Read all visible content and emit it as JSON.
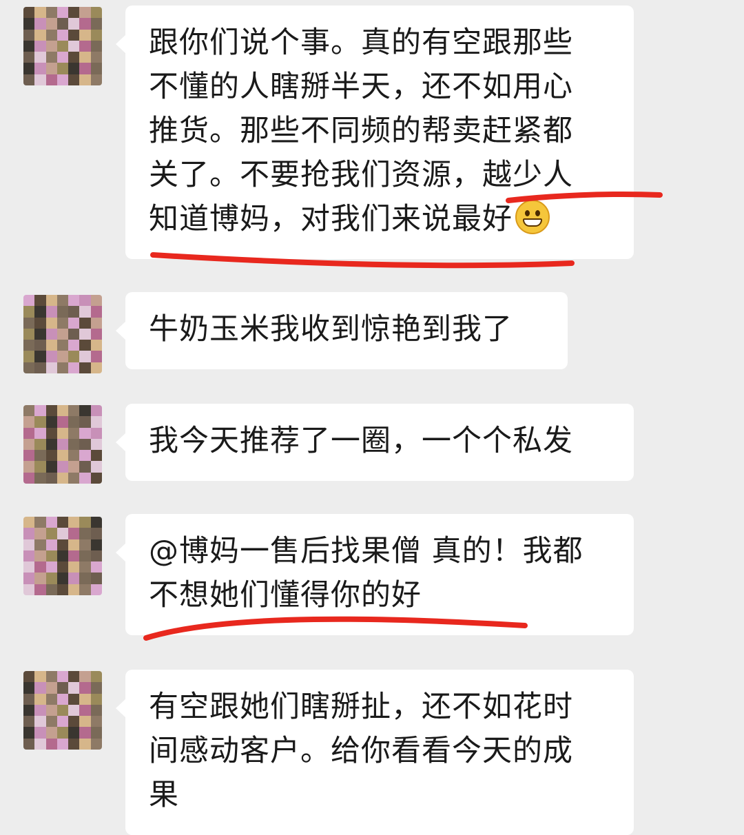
{
  "colors": {
    "background": "#ededed",
    "bubble": "#ffffff",
    "text": "#1a1a1a",
    "annotation_underline": "#e8281e"
  },
  "messages": [
    {
      "lines": [
        "跟你们说个事。真的有空跟那些",
        "不懂的人瞎掰半天，还不如用心",
        "推货。那些不同频的帮卖赶紧都",
        "关了。不要抢我们资源，越少人",
        "知道博妈，对我们来说最好"
      ],
      "emoji": "grinning-face-icon"
    },
    {
      "lines": [
        "牛奶玉米我收到惊艳到我了"
      ]
    },
    {
      "lines": [
        "我今天推荐了一圈，一个个私发"
      ]
    },
    {
      "lines": [
        "@博妈一售后找果僧 真的！我都",
        "不想她们懂得你的好"
      ]
    },
    {
      "lines": [
        "有空跟她们瞎掰扯，还不如花时",
        "间感动客户。给你看看今天的成",
        "果"
      ]
    }
  ]
}
